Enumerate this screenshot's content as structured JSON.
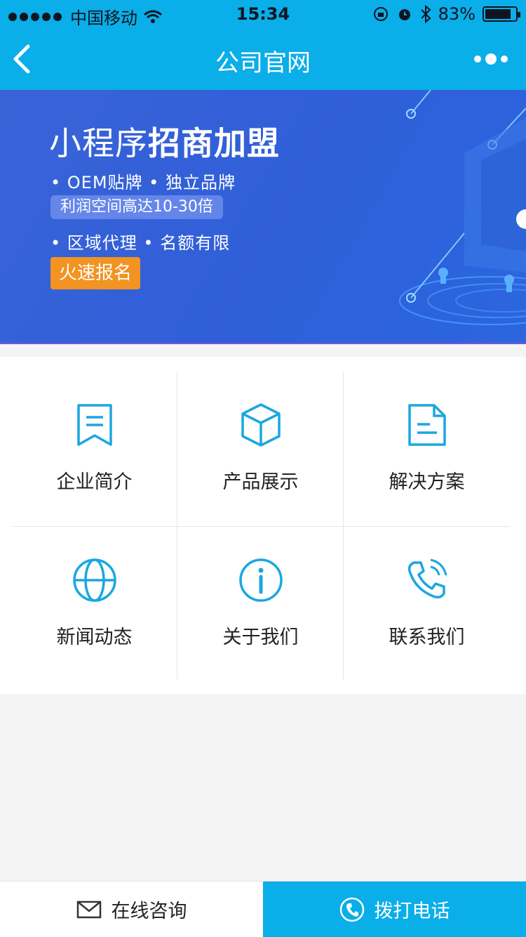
{
  "status": {
    "carrier": "中国移动",
    "time": "15:34",
    "battery": "83%"
  },
  "nav": {
    "title": "公司官网"
  },
  "banner": {
    "headline_light": "小程序",
    "headline_bold": "招商加盟",
    "line1": "• OEM贴牌 • 独立品牌",
    "pill": "利润空间高达10-30倍",
    "line2": "• 区域代理 • 名额有限",
    "cta": "火速报名"
  },
  "grid": {
    "items": [
      {
        "label": "企业简介",
        "icon": "bookmark-doc-icon"
      },
      {
        "label": "产品展示",
        "icon": "cube-icon"
      },
      {
        "label": "解决方案",
        "icon": "document-icon"
      },
      {
        "label": "新闻动态",
        "icon": "globe-icon"
      },
      {
        "label": "关于我们",
        "icon": "info-icon"
      },
      {
        "label": "联系我们",
        "icon": "phone-ringing-icon"
      }
    ]
  },
  "bottom": {
    "consult": "在线咨询",
    "call": "拨打电话"
  },
  "colors": {
    "primary": "#0aaee8",
    "banner": "#2f5fd9",
    "cta": "#f29322",
    "icon": "#1aa7e0"
  }
}
